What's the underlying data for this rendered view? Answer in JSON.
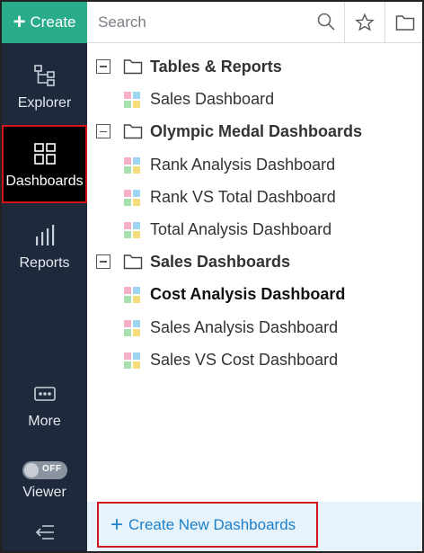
{
  "sidebar": {
    "create_label": "Create",
    "items": [
      {
        "label": "Explorer",
        "icon": "explorer-icon"
      },
      {
        "label": "Dashboards",
        "icon": "dashboards-icon",
        "active": true
      },
      {
        "label": "Reports",
        "icon": "reports-icon"
      },
      {
        "label": "More",
        "icon": "more-icon"
      },
      {
        "label": "Viewer",
        "icon": "toggle-icon"
      }
    ],
    "viewer_toggle_text": "OFF"
  },
  "search": {
    "placeholder": "Search"
  },
  "tree": {
    "groups": [
      {
        "label": "Tables & Reports",
        "items": [
          "Sales Dashboard"
        ]
      },
      {
        "label": "Olympic Medal Dashboards",
        "items": [
          "Rank Analysis Dashboard",
          "Rank VS Total Dashboard",
          "Total Analysis Dashboard"
        ]
      },
      {
        "label": "Sales Dashboards",
        "items": [
          "Cost Analysis Dashboard",
          "Sales Analysis Dashboard",
          "Sales VS Cost Dashboard"
        ]
      }
    ],
    "active_item": "Cost Analysis Dashboard"
  },
  "bottom": {
    "create_new_label": "Create New Dashboards"
  },
  "colors": {
    "sidebar_bg": "#1e2a3c",
    "create_green": "#2aab89",
    "highlight_red": "#d1151b",
    "link_blue": "#1c7fc9"
  }
}
